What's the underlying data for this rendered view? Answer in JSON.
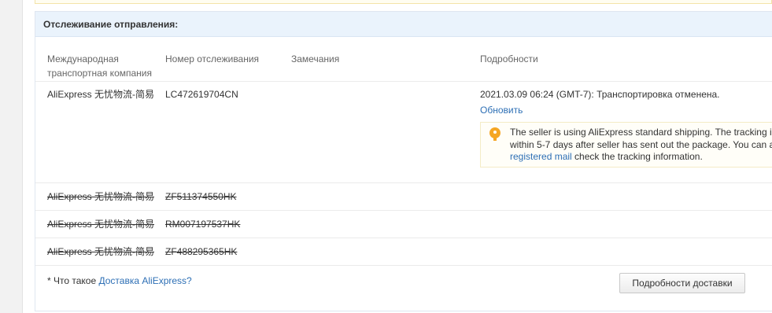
{
  "section": {
    "title": "Отслеживание отправления:"
  },
  "table": {
    "headers": {
      "carrier": "Международная транспортная компания",
      "tracking": "Номер отслеживания",
      "remarks": "Замечания",
      "details": "Подробности"
    },
    "active": {
      "carrier": "AliExpress 无忧物流-简易",
      "tracking": "LC472619704CN",
      "remarks": "",
      "status": "2021.03.09 06:24 (GMT-7): Транспортировка отменена.",
      "refresh_label": "Обновить",
      "tip": {
        "line1": "The seller is using AliExpress standard shipping. The tracking i",
        "line2": "within 5-7 days after seller has sent out the package. You can a",
        "link": "registered mail",
        "line3_rest": " check the tracking information."
      }
    },
    "canceled_rows": [
      {
        "carrier": "AliExpress 无忧物流-简易",
        "tracking": "ZF511374550HK"
      },
      {
        "carrier": "AliExpress 无忧物流-简易",
        "tracking": "RM007197537HK"
      },
      {
        "carrier": "AliExpress 无忧物流-简易",
        "tracking": "ZF488295365HK"
      }
    ]
  },
  "footer": {
    "question_prefix": "* Что такое ",
    "question_link": "Доставка AliExpress?",
    "details_button": "Подробности доставки"
  },
  "colors": {
    "link": "#2d6fb5",
    "header_bg": "#eaf3fc",
    "tip_icon": "#f5a623"
  }
}
